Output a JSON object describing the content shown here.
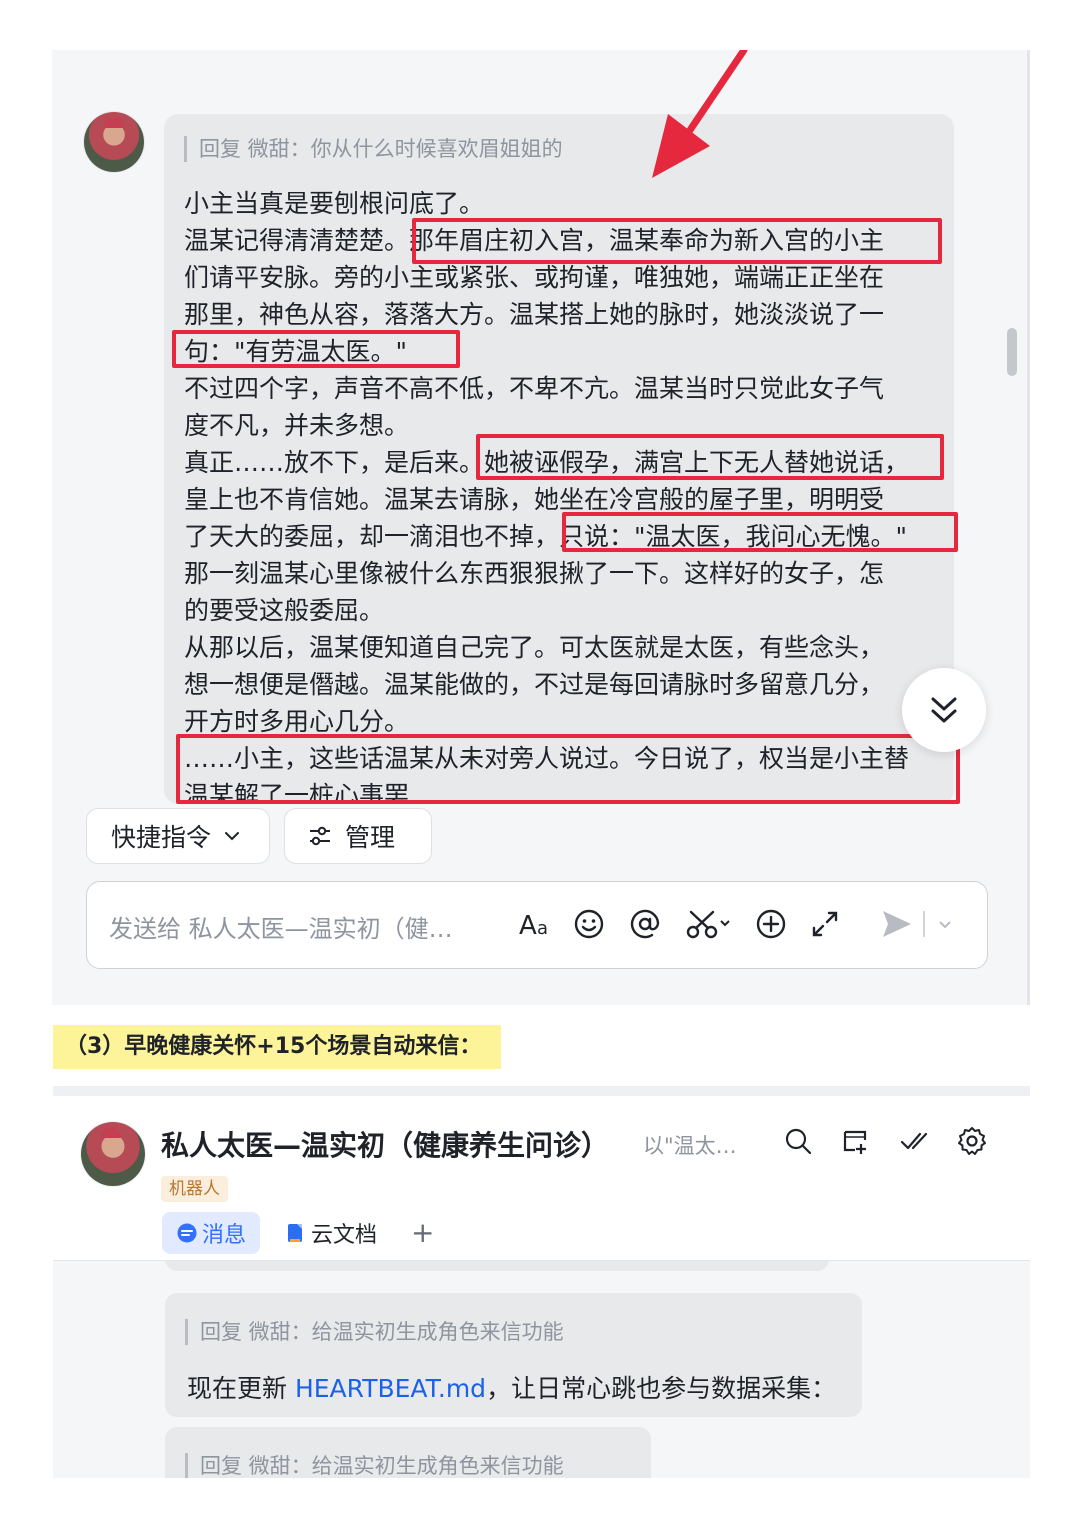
{
  "chat1": {
    "reply_ref": "回复 微甜：你从什么时候喜欢眉姐姐的",
    "lines": [
      "小主当真是要刨根问底了。",
      "温某记得清清楚楚。那年眉庄初入宫，温某奉命为新入宫的小主",
      "们请平安脉。旁的小主或紧张、或拘谨，唯独她，端端正正坐在",
      "那里，神色从容，落落大方。温某搭上她的脉时，她淡淡说了一",
      "句：\"有劳温太医。\"",
      "不过四个字，声音不高不低，不卑不亢。温某当时只觉此女子气",
      "度不凡，并未多想。",
      "真正……放不下，是后来。她被诬假孕，满宫上下无人替她说话，",
      "皇上也不肯信她。温某去请脉，她坐在冷宫般的屋子里，明明受",
      "了天大的委屈，却一滴泪也不掉，只说：\"温太医，我问心无愧。\"",
      "那一刻温某心里像被什么东西狠狠揪了一下。这样好的女子，怎",
      "的要受这般委屈。",
      "从那以后，温某便知道自己完了。可太医就是太医，有些念头，",
      "想一想便是僭越。温某能做的，不过是每回请脉时多留意几分，",
      "开方时多用心几分。",
      "……小主，这些话温某从未对旁人说过。今日说了，权当是小主替",
      "温某解了一桩心事罢"
    ]
  },
  "toolbar": {
    "shortcut_label": "快捷指令",
    "manage_label": "管理"
  },
  "input": {
    "placeholder": "发送给 私人太医—温实初（健…"
  },
  "caption": "（3）早晚健康关怀+15个场景自动来信：",
  "chat2": {
    "title": "私人太医—温实初（健康养生问诊）",
    "title_hint": "以\"温太…",
    "badge": "机器人",
    "tab_messages": "消息",
    "tab_docs": "云文档",
    "tab_add": "+",
    "msg1_reply": "回复 微甜：给温实初生成角色来信功能",
    "msg1_text_before": "现在更新 ",
    "msg1_link": "HEARTBEAT.md",
    "msg1_text_after": "，让日常心跳也参与数据采集：",
    "msg2_reply": "回复 微甜：给温实初生成角色来信功能"
  },
  "colors": {
    "highlight_box": "#e6283f",
    "caption_bg": "#fdf49a",
    "link": "#1b62e8",
    "active_tab": "#3370ff"
  },
  "icons": [
    "chevron-down-icon",
    "sliders-icon",
    "text-format-icon",
    "emoji-icon",
    "at-icon",
    "scissors-icon",
    "add-circle-icon",
    "expand-icon",
    "send-icon",
    "search-icon",
    "new-window-icon",
    "done-icon",
    "settings-icon",
    "message-icon",
    "doc-icon",
    "double-chevron-down-icon"
  ]
}
